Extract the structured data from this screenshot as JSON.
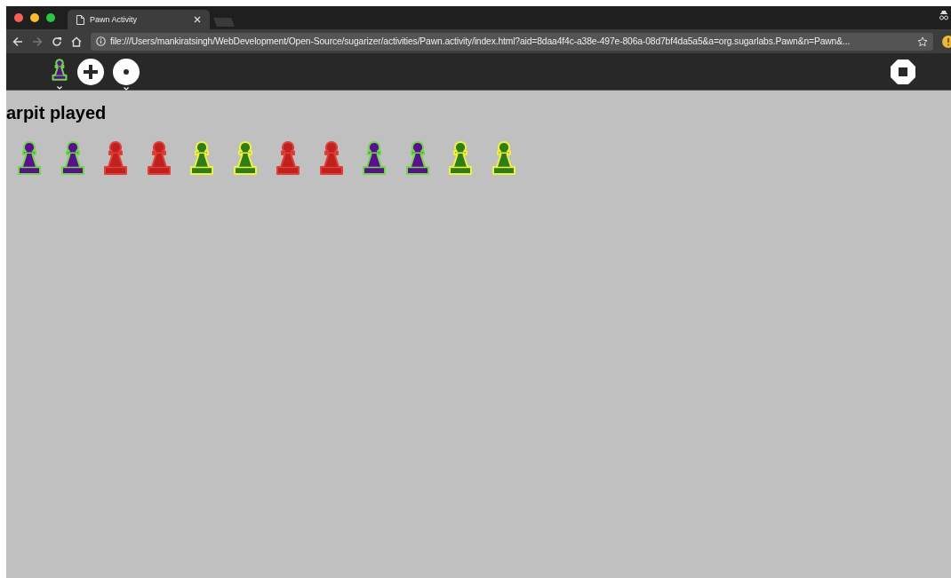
{
  "browser": {
    "tab_title": "Pawn Activity",
    "address": "file:///Users/mankiratsingh/WebDevelopment/Open-Source/sugarizer/activities/Pawn.activity/index.html?aid=8daa4f4c-a38e-497e-806a-08d7bf4da5a5&a=org.sugarlabs.Pawn&n=Pawn&..."
  },
  "toolbar": {
    "activity_pawn": {
      "color": "#5a0f8c",
      "outline": {
        "color": "#6fd84a"
      }
    }
  },
  "message": "arpit played",
  "pawns": [
    {
      "color": "#5a0f8c",
      "outline": {
        "color": "#6fd84a"
      }
    },
    {
      "color": "#5a0f8c",
      "outline": {
        "color": "#6fd84a"
      }
    },
    {
      "color": "#c0201e",
      "outline": {
        "color": "#e0403c"
      }
    },
    {
      "color": "#c0201e",
      "outline": {
        "color": "#e0403c"
      }
    },
    {
      "color": "#2e7d16",
      "outline": {
        "color": "#f0f040"
      }
    },
    {
      "color": "#2e7d16",
      "outline": {
        "color": "#f0f040"
      }
    },
    {
      "color": "#c0201e",
      "outline": {
        "color": "#e0403c"
      }
    },
    {
      "color": "#c0201e",
      "outline": {
        "color": "#e0403c"
      }
    },
    {
      "color": "#5a0f8c",
      "outline": {
        "color": "#6fd84a"
      }
    },
    {
      "color": "#5a0f8c",
      "outline": {
        "color": "#6fd84a"
      }
    },
    {
      "color": "#2e7d16",
      "outline": {
        "color": "#f0f040"
      }
    },
    {
      "color": "#2e7d16",
      "outline": {
        "color": "#f0f040"
      }
    }
  ]
}
